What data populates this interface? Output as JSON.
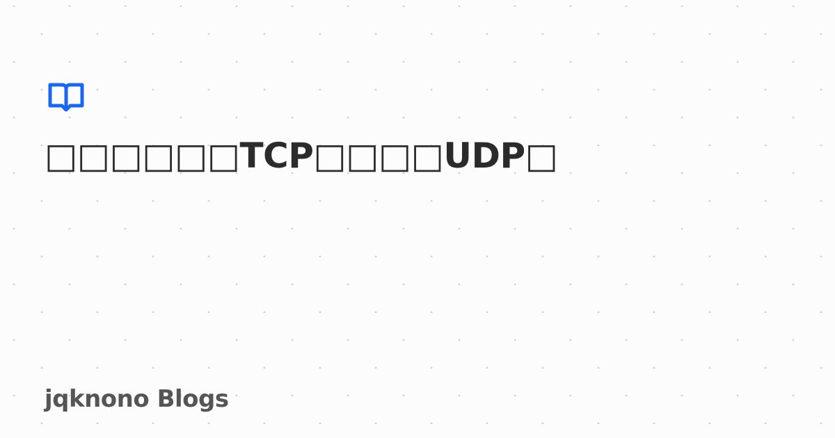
{
  "post": {
    "title": "□□□□□□TCP□□□□UDP□"
  },
  "site": {
    "name": "jqknono Blogs",
    "logo_icon": "open-book-icon"
  },
  "colors": {
    "background": "#fcfcfc",
    "dot": "#d0d0d0",
    "accent": "#1a66f0",
    "title_text": "#2b2b2b",
    "site_text": "#555555"
  }
}
